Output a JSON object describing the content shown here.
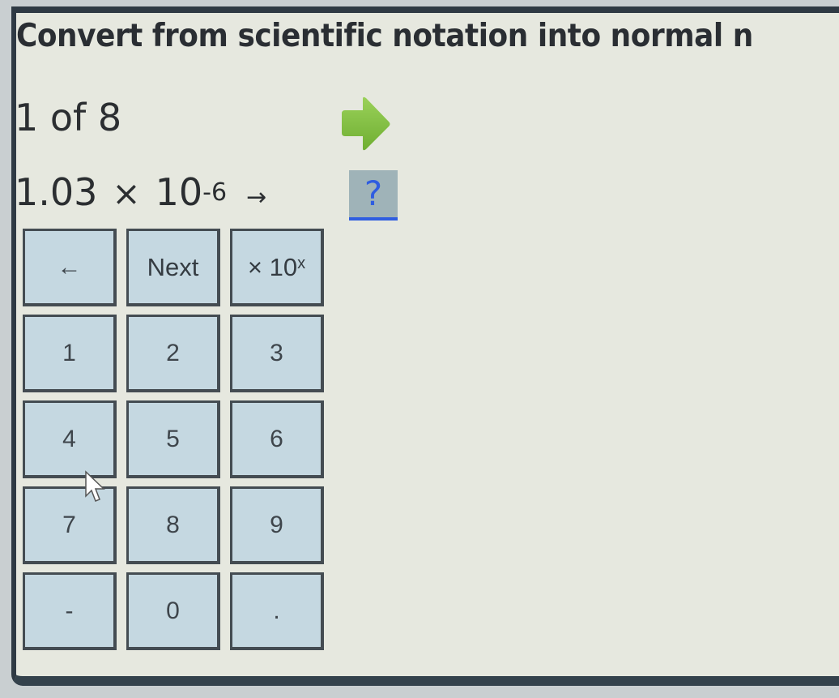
{
  "header": {
    "title": "Convert from scientific notation into normal n"
  },
  "progress": {
    "counter": "1 of 8",
    "next_icon": "green-right-arrow"
  },
  "problem": {
    "coefficient": "1.03",
    "times": "×",
    "base": "10",
    "exponent": "-6",
    "arrow": "→",
    "answer_placeholder": "?"
  },
  "keypad": {
    "keys": [
      {
        "label": "←",
        "name": "backspace-key"
      },
      {
        "label": "Next",
        "name": "next-key"
      },
      {
        "label": "× 10",
        "sup": "x",
        "name": "times-ten-power-key"
      },
      {
        "label": "1",
        "name": "key-1"
      },
      {
        "label": "2",
        "name": "key-2"
      },
      {
        "label": "3",
        "name": "key-3"
      },
      {
        "label": "4",
        "name": "key-4"
      },
      {
        "label": "5",
        "name": "key-5"
      },
      {
        "label": "6",
        "name": "key-6"
      },
      {
        "label": "7",
        "name": "key-7"
      },
      {
        "label": "8",
        "name": "key-8"
      },
      {
        "label": "9",
        "name": "key-9"
      },
      {
        "label": "-",
        "name": "key-minus"
      },
      {
        "label": "0",
        "name": "key-0"
      },
      {
        "label": ".",
        "name": "key-decimal"
      }
    ]
  },
  "colors": {
    "key_fill": "#c5d8e1",
    "answer_fill": "#9fb3b8",
    "answer_accent": "#2f5de0",
    "next_arrow": "#7fbf3f"
  }
}
